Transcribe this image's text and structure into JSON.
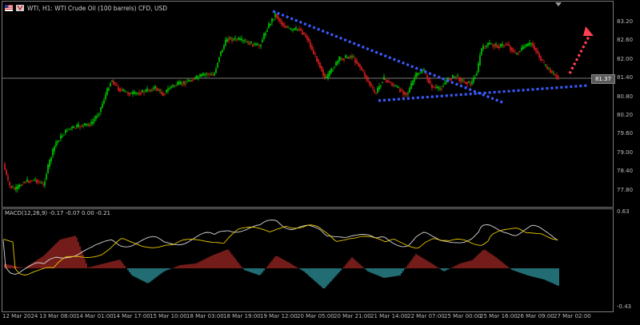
{
  "header": {
    "symbol_text": "WTI, H1:  WTI Crude Oil (100 barrels) CFD, USD"
  },
  "price_axis": [
    "83.20",
    "82.60",
    "82.00",
    "81.40",
    "80.80",
    "80.20",
    "79.60",
    "79.00",
    "78.40",
    "77.80"
  ],
  "current_price": "81.37",
  "macd": {
    "label": "MACD(12,26,9) -0.17 -0.07 0.00 -0.21",
    "axis_top": "0.63",
    "axis_bottom": "-0.43"
  },
  "time_axis": [
    "12 Mar 2024",
    "13 Mar 08:00",
    "14 Mar 01:00",
    "14 Mar 17:00",
    "15 Mar 10:00",
    "18 Mar 03:00",
    "18 Mar 19:00",
    "19 Mar 12:00",
    "20 Mar 05:00",
    "20 Mar 21:00",
    "21 Mar 14:00",
    "22 Mar 07:00",
    "25 Mar 00:00",
    "25 Mar 16:00",
    "26 Mar 09:00",
    "27 Mar 02:00"
  ],
  "colors": {
    "bull": "#00d000",
    "bear": "#e02020",
    "trend": "#3a5bff",
    "arrow": "#ff4050",
    "macd_pos": "#c0302a",
    "macd_neg": "#3ab6c0",
    "signal": "#e8c800",
    "macd_line": "#d8d8d8"
  }
}
